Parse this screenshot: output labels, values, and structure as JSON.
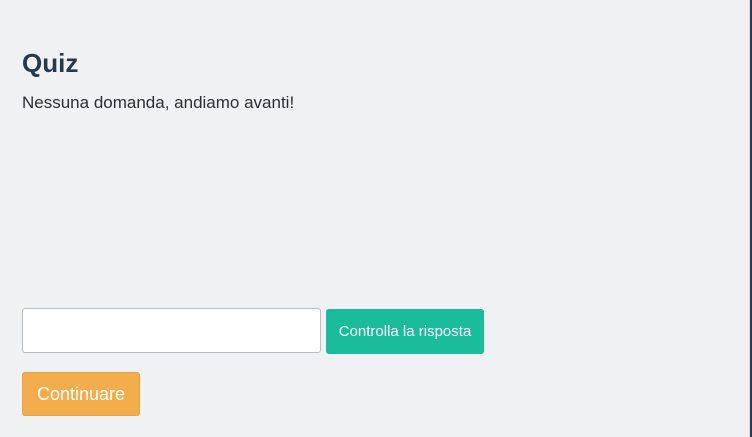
{
  "quiz": {
    "title": "Quiz",
    "message": "Nessuna domanda, andiamo avanti!",
    "answer_value": "",
    "answer_placeholder": "",
    "check_label": "Controlla la risposta",
    "continue_label": "Continuare"
  },
  "colors": {
    "panel_background": "#eff1f3",
    "title_text": "#253a4f",
    "check_button": "#1abc9c",
    "continue_button": "#f3ad4d",
    "right_edge": "#2c3e50"
  }
}
